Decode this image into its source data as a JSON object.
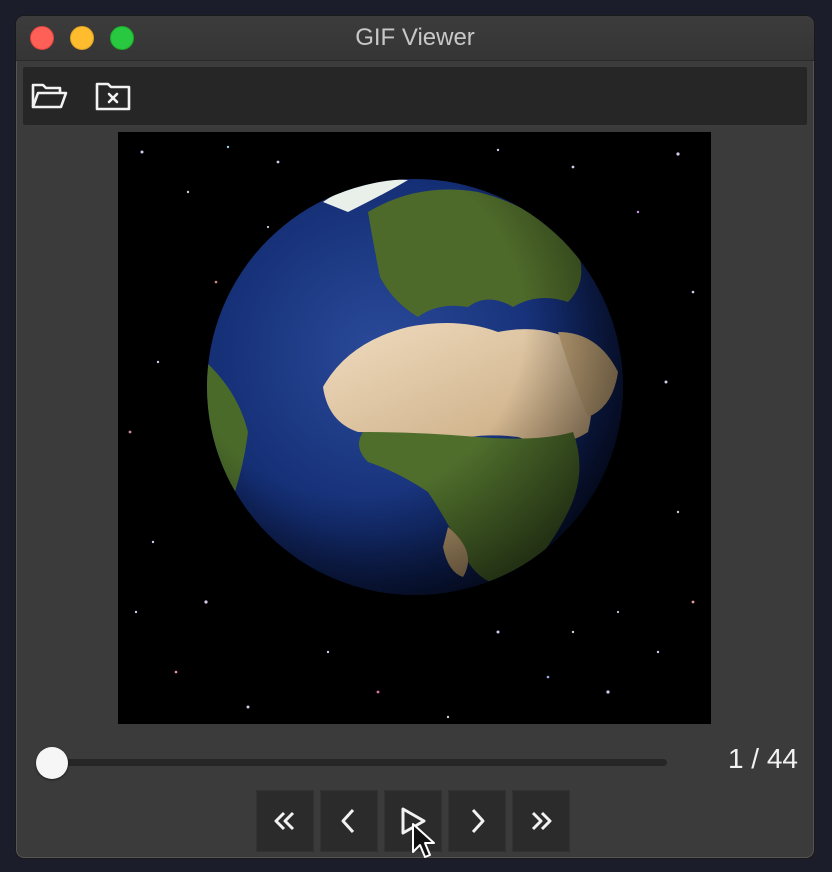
{
  "window": {
    "title": "GIF Viewer",
    "colors": {
      "close": "#fe5f57",
      "minimize": "#febc2e",
      "maximize": "#28c840",
      "background": "#3b3b3b",
      "toolbar": "#262626"
    }
  },
  "toolbar": {
    "buttons": [
      {
        "name": "open-file",
        "icon": "folder-open-icon"
      },
      {
        "name": "close-file",
        "icon": "folder-x-icon"
      }
    ]
  },
  "image": {
    "description_icon": "earth-globe-image"
  },
  "playback": {
    "current_frame": 1,
    "total_frames": 44,
    "frame_label": "1 / 44",
    "position_fraction": 0.0,
    "controls": [
      {
        "name": "first-frame",
        "icon": "double-chevron-left-icon"
      },
      {
        "name": "previous-frame",
        "icon": "chevron-left-icon"
      },
      {
        "name": "play",
        "icon": "play-icon"
      },
      {
        "name": "next-frame",
        "icon": "chevron-right-icon"
      },
      {
        "name": "last-frame",
        "icon": "double-chevron-right-icon"
      }
    ]
  }
}
